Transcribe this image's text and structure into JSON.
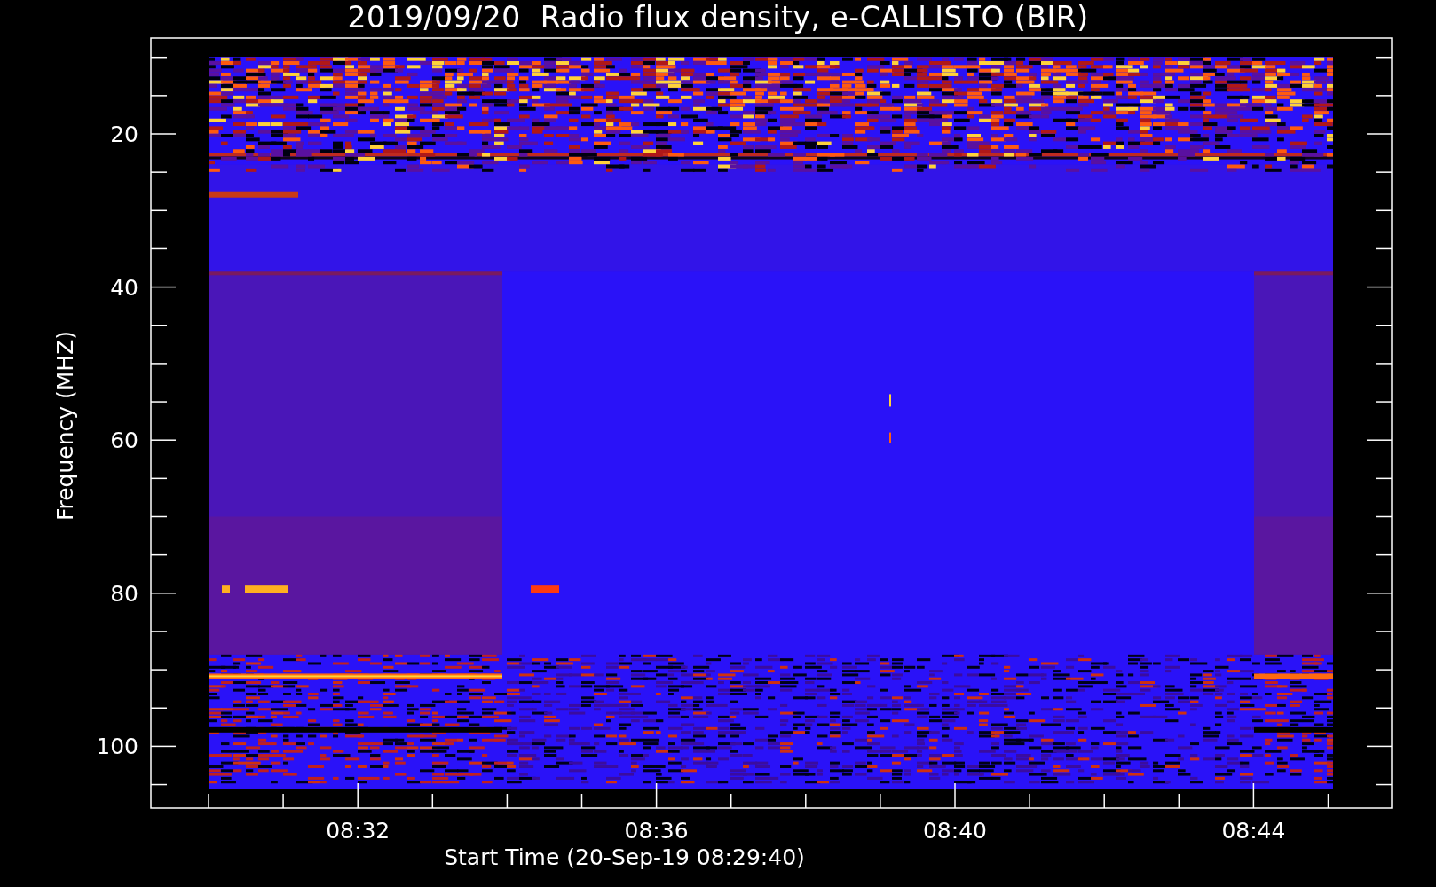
{
  "title": "2019/09/20  Radio flux density, e-CALLISTO (BIR)",
  "y_axis": {
    "label": "Frequency (MHZ)",
    "ticks": [
      "20",
      "40",
      "60",
      "80",
      "100"
    ]
  },
  "x_axis": {
    "label": "Start Time (20-Sep-19 08:29:40)",
    "ticks": [
      "08:32",
      "08:36",
      "08:40",
      "08:44"
    ]
  }
}
